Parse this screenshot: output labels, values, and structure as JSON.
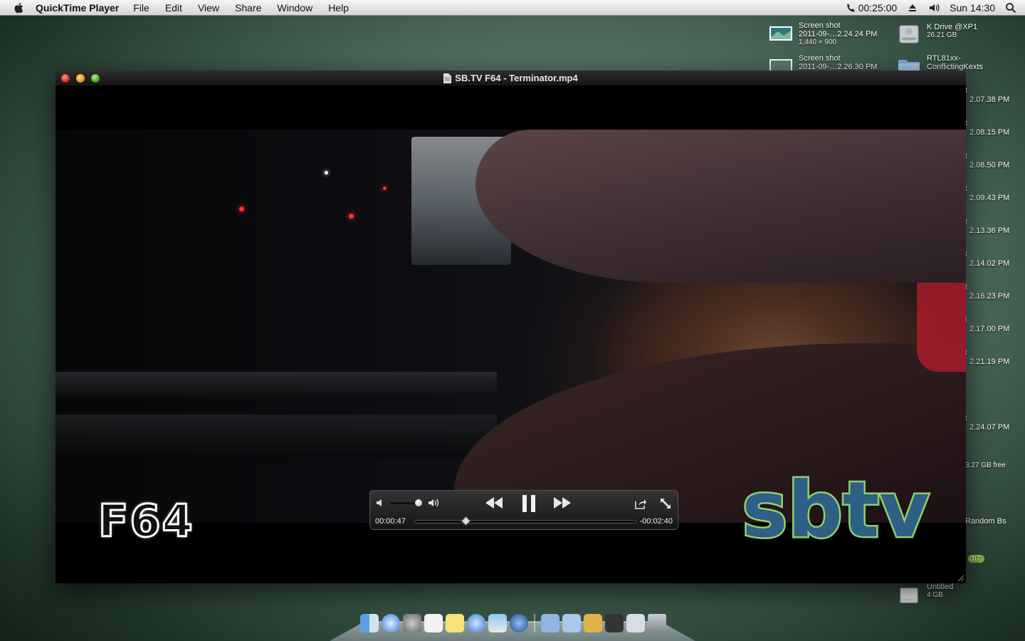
{
  "menubar": {
    "app_name": "QuickTime Player",
    "items": [
      "File",
      "Edit",
      "View",
      "Share",
      "Window",
      "Help"
    ],
    "timer": "00:25:00",
    "clock": "Sun 14:30"
  },
  "desktop": {
    "screenshot1": {
      "line1": "Screen shot",
      "line2": "2011-09-…2.24.24 PM",
      "line3": "1,440 × 900"
    },
    "screenshot2": {
      "line1": "Screen shot",
      "line2": "2011-09-…2.26.30 PM"
    },
    "kdrive": {
      "name": "K Drive @XP1",
      "size": "26.21 GB"
    },
    "folder": {
      "line1": "RTL81xx-",
      "line2": "ConflictingKexts"
    },
    "untitled": {
      "name": "Untitled",
      "size": "4 GB"
    },
    "right_labels": [
      {
        "a": "t",
        "b": "2.07.38 PM"
      },
      {
        "a": "t",
        "b": "2.08.15 PM"
      },
      {
        "a": "t",
        "b": "2.08.50 PM"
      },
      {
        "a": "t",
        "b": "2.09.43 PM"
      },
      {
        "a": "t",
        "b": "2.13.36 PM"
      },
      {
        "a": "t",
        "b": "2.14.02 PM"
      },
      {
        "a": "t",
        "b": "2.16.23 PM"
      },
      {
        "a": "t",
        "b": "2.17.00 PM"
      },
      {
        "a": "t",
        "b": "2.21.19 PM"
      },
      {
        "a": "t",
        "b": "2.24.07 PM"
      }
    ],
    "free_space": "3.27 GB free",
    "random_label": "Random Bs",
    "tag_label": "b7"
  },
  "player": {
    "title": "SB.TV F64 - Terminator.mp4",
    "overlay_left": "F64",
    "overlay_right": "sbtv",
    "current_time": "00:00:47",
    "remaining_time": "-00:02:40",
    "progress_fraction": 0.23,
    "volume_fraction": 0.9
  },
  "colors": {
    "sbtv_fill": "#2e5f86",
    "sbtv_stroke": "#8fd06a",
    "accent_red": "#ff3232"
  },
  "icons": {
    "volume_low": "speaker-low-icon",
    "volume_high": "speaker-high-icon",
    "rewind": "rewind-icon",
    "pause": "pause-icon",
    "fast_forward": "fast-forward-icon",
    "share": "share-icon",
    "fullscreen": "fullscreen-icon"
  }
}
